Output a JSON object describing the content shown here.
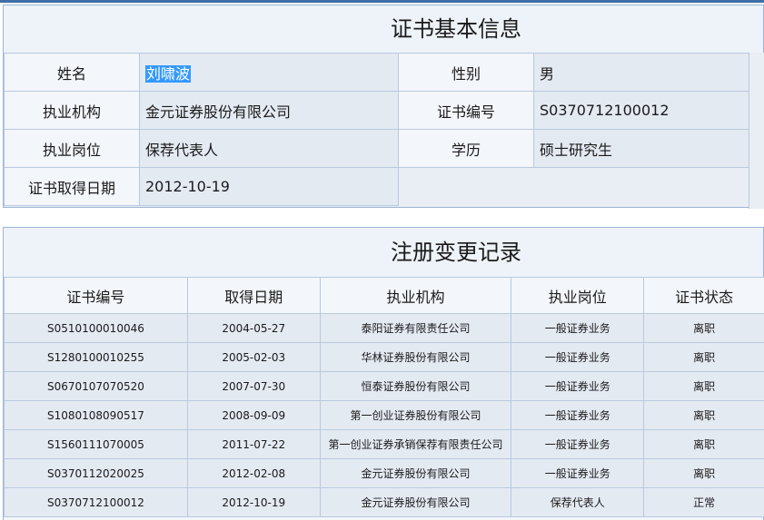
{
  "basic_info": {
    "title": "证书基本信息",
    "rows": [
      {
        "label1": "姓名",
        "value1": "刘啸波",
        "label2": "性别",
        "value2": "男"
      },
      {
        "label1": "执业机构",
        "value1": "金元证券股份有限公司",
        "label2": "证书编号",
        "value2": "S0370712100012"
      },
      {
        "label1": "执业岗位",
        "value1": "保荐代表人",
        "label2": "学历",
        "value2": "硕士研究生"
      },
      {
        "label1": "证书取得日期",
        "value1": "2012-10-19"
      }
    ]
  },
  "change_records": {
    "title": "注册变更记录",
    "headers": [
      "证书编号",
      "取得日期",
      "执业机构",
      "执业岗位",
      "证书状态"
    ],
    "rows": [
      [
        "S0510100010046",
        "2004-05-27",
        "泰阳证券有限责任公司",
        "一般证券业务",
        "离职"
      ],
      [
        "S1280100010255",
        "2005-02-03",
        "华林证券股份有限公司",
        "一般证券业务",
        "离职"
      ],
      [
        "S0670107070520",
        "2007-07-30",
        "恒泰证券股份有限公司",
        "一般证券业务",
        "离职"
      ],
      [
        "S1080108090517",
        "2008-09-09",
        "第一创业证券股份有限公司",
        "一般证券业务",
        "离职"
      ],
      [
        "S1560111070005",
        "2011-07-22",
        "第一创业证券承销保荐有限责任公司",
        "一般证券业务",
        "离职"
      ],
      [
        "S0370112020025",
        "2012-02-08",
        "金元证券股份有限公司",
        "一般证券业务",
        "离职"
      ],
      [
        "S0370712100012",
        "2012-10-19",
        "金元证券股份有限公司",
        "保荐代表人",
        "正常"
      ]
    ]
  }
}
